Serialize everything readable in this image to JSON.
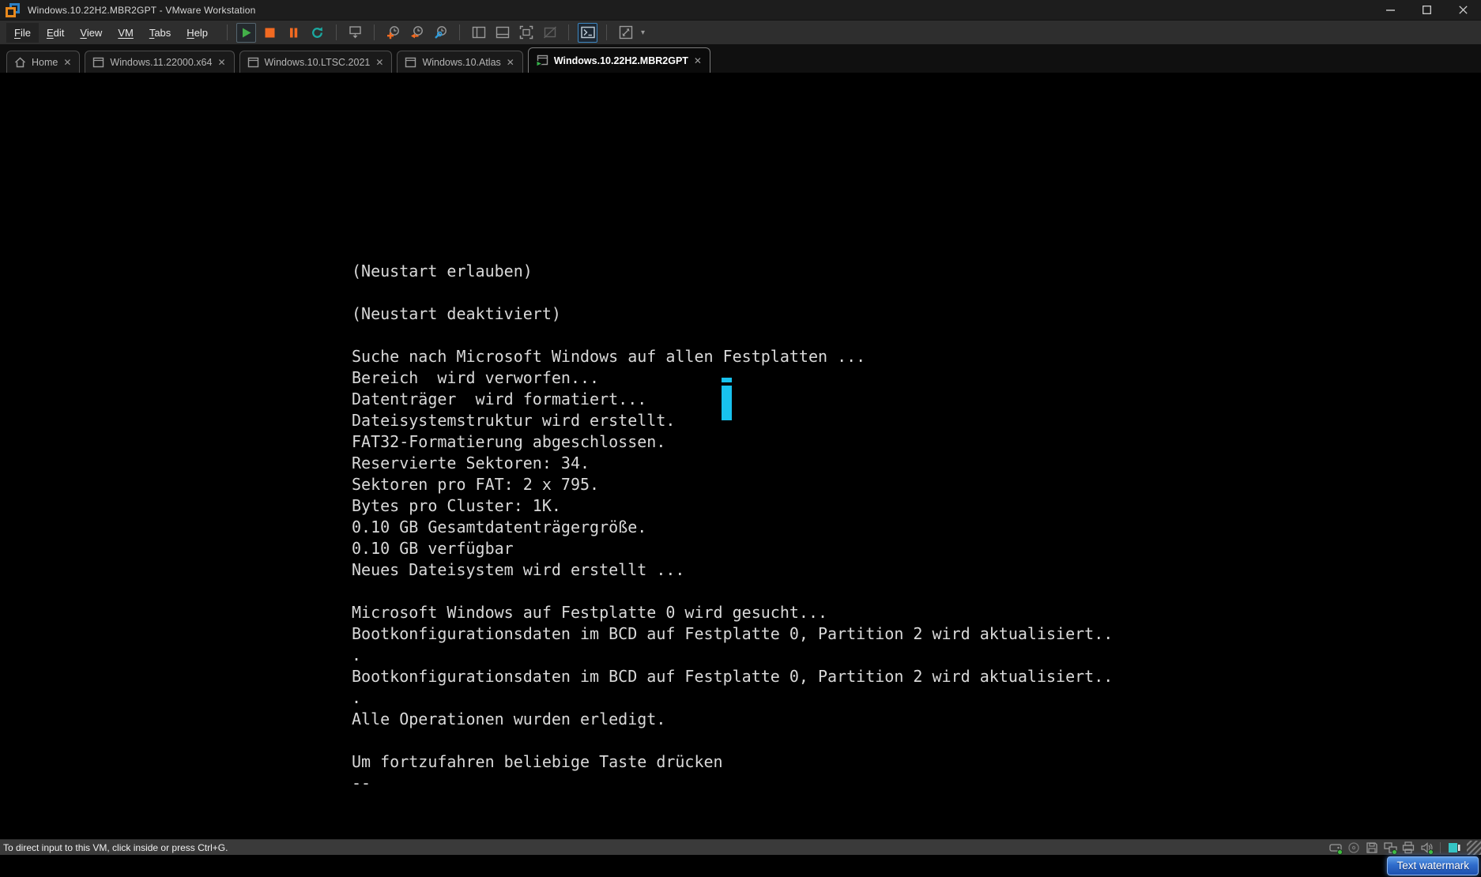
{
  "window": {
    "title": "Windows.10.22H2.MBR2GPT - VMware Workstation",
    "controls": [
      "minimize",
      "maximize",
      "close"
    ]
  },
  "menu": {
    "items": [
      {
        "key": "F",
        "rest": "ile"
      },
      {
        "key": "E",
        "rest": "dit"
      },
      {
        "key": "V",
        "rest": "iew"
      },
      {
        "key": "VM",
        "rest": ""
      },
      {
        "key": "T",
        "rest": "abs"
      },
      {
        "key": "H",
        "rest": "elp"
      }
    ]
  },
  "toolbar": {
    "icons": [
      "power-on",
      "power-off",
      "suspend",
      "reset",
      "send-ctrl-alt-del",
      "take-snapshot",
      "revert-snapshot",
      "snapshot-manager",
      "show-library",
      "show-thumbnail-bar",
      "full-screen",
      "unity-disabled",
      "console-view",
      "autosize"
    ],
    "active_icon": "console-view",
    "pressed_icon": "power-on"
  },
  "tabs": [
    {
      "label": "Home",
      "icon": "home-icon",
      "active": false
    },
    {
      "label": "Windows.11.22000.x64",
      "icon": "vm-icon",
      "active": false
    },
    {
      "label": "Windows.10.LTSC.2021",
      "icon": "vm-icon",
      "active": false
    },
    {
      "label": "Windows.10.Atlas",
      "icon": "vm-icon",
      "active": false
    },
    {
      "label": "Windows.10.22H2.MBR2GPT",
      "icon": "vm-running-icon",
      "active": true
    }
  ],
  "icons": {
    "close_tab": "✕",
    "caret": "▾"
  },
  "console": {
    "text": "(Neustart erlauben)\n\n(Neustart deaktiviert)\n\nSuche nach Microsoft Windows auf allen Festplatten ...\nBereich  wird verworfen...\nDatenträger  wird formatiert...\nDateisystemstruktur wird erstellt.\nFAT32-Formatierung abgeschlossen.\nReservierte Sektoren: 34.\nSektoren pro FAT: 2 x 795.\nBytes pro Cluster: 1K.\n0.10 GB Gesamtdatenträgergröße.\n0.10 GB verfügbar\nNeues Dateisystem wird erstellt ...\n\nMicrosoft Windows auf Festplatte 0 wird gesucht...\nBootkonfigurationsdaten im BCD auf Festplatte 0, Partition 2 wird aktualisiert..\n.\nBootkonfigurationsdaten im BCD auf Festplatte 0, Partition 2 wird aktualisiert..\n.\nAlle Operationen wurden erledigt.\n\nUm fortzufahren beliebige Taste drücken\n--",
    "cursor_color": "#18c2ee"
  },
  "statusbar": {
    "hint": "To direct input to this VM, click inside or press Ctrl+G.",
    "devices": [
      {
        "name": "hard-disk",
        "connected": true
      },
      {
        "name": "cd-dvd",
        "connected": false
      },
      {
        "name": "floppy",
        "connected": false
      },
      {
        "name": "network-adapter",
        "connected": true
      },
      {
        "name": "printer",
        "connected": false
      },
      {
        "name": "sound",
        "connected": true
      }
    ],
    "connected_color": "#3fbf3f"
  },
  "watermark": {
    "label": "Text watermark"
  },
  "colors": {
    "titlebar_bg": "#1d1d1d",
    "menubar_bg": "#2e2e2e",
    "tabbar_bg": "#101010",
    "console_bg": "#000000",
    "console_text": "#d9d9d9",
    "accent_green": "#43b049",
    "accent_orange": "#f26a21",
    "accent_teal": "#1ba8a0",
    "accent_blue": "#2e9ad8",
    "statusbar_bg": "#3a3a3a",
    "watermark_blue": "#2f6ccb"
  }
}
